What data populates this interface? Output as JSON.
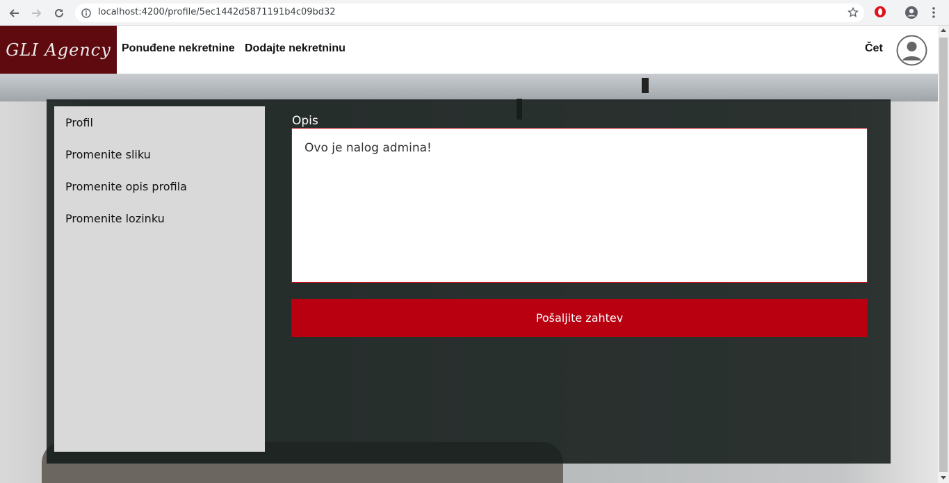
{
  "browser": {
    "url": "localhost:4200/profile/5ec1442d5871191b4c09bd32",
    "icons": [
      "back-icon",
      "forward-icon",
      "reload-icon",
      "info-icon",
      "star-icon",
      "opera-icon",
      "account-icon",
      "menu-icon"
    ]
  },
  "header": {
    "logo": "GLI Agency",
    "nav": [
      "Ponuđene nekretnine",
      "Dodajte nekretninu"
    ],
    "chat": "Čet"
  },
  "sidebar": {
    "items": [
      {
        "label": "Profil"
      },
      {
        "label": "Promenite sliku"
      },
      {
        "label": "Promenite opis profila"
      },
      {
        "label": "Promenite lozinku"
      }
    ]
  },
  "form": {
    "label": "Opis",
    "value": "Ovo je nalog admina!",
    "submit": "Pošaljite zahtev"
  },
  "colors": {
    "brand": "#5e0a0e",
    "accent": "#b80010",
    "panel": "#141c1a"
  }
}
